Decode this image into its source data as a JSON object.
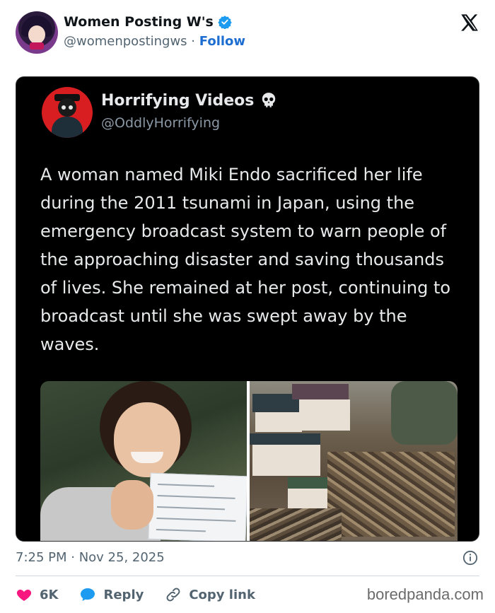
{
  "author": {
    "display_name": "Women Posting W's",
    "handle": "@womenpostingws",
    "separator": "·",
    "follow_label": "Follow"
  },
  "embedded": {
    "display_name": "Horrifying Videos",
    "handle": "@OddlyHorrifying",
    "text": "A woman named Miki Endo sacrificed her life during the 2011 tsunami in Japan, using the emergency broadcast system to warn people of the approaching disaster and saving thousands of lives. She remained at her post, continuing to broadcast until she was swept away by the waves."
  },
  "timestamp": "7:25 PM · Nov 25, 2025",
  "actions": {
    "like_count": "6K",
    "reply_label": "Reply",
    "copy_label": "Copy link"
  },
  "watermark": "boredpanda.com",
  "colors": {
    "link": "#1d6ed0",
    "like": "#f91880",
    "reply": "#1d9bf0",
    "embed_bg": "#000000"
  },
  "icons": {
    "verified": "verified-badge-icon",
    "x_logo": "x-logo-icon",
    "skull": "skull-icon",
    "info": "info-icon",
    "heart": "heart-icon",
    "reply": "speech-bubble-icon",
    "link": "link-icon"
  }
}
